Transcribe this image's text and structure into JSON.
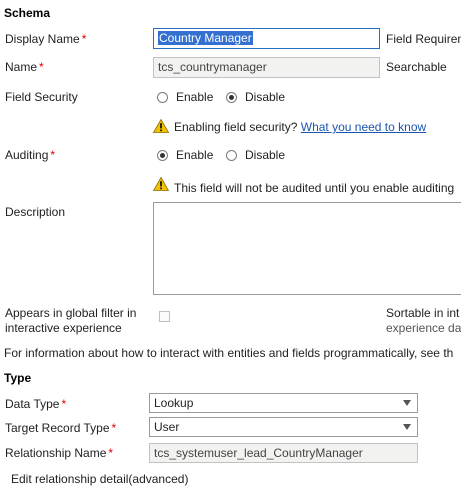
{
  "schema": {
    "header": "Schema",
    "display_name": {
      "label": "Display Name",
      "value": "Country Manager"
    },
    "field_requirement_label": "Field Requiren",
    "name": {
      "label": "Name",
      "value": "tcs_countrymanager"
    },
    "searchable_label": "Searchable",
    "field_security": {
      "label": "Field Security",
      "enable": "Enable",
      "disable": "Disable",
      "selected": "Disable",
      "warning_text": "Enabling field security?",
      "warning_link": "What you need to know"
    },
    "auditing": {
      "label": "Auditing",
      "enable": "Enable",
      "disable": "Disable",
      "selected": "Enable",
      "warning_text": "This field will not be audited until you enable auditing"
    },
    "description": {
      "label": "Description",
      "value": ""
    },
    "global_filter": {
      "label_line1": "Appears in global filter in",
      "label_line2": "interactive experience",
      "checked": false
    },
    "sortable": {
      "label_line1": "Sortable in int",
      "label_line2": "experience da"
    },
    "info_text": "For information about how to interact with entities and fields programmatically, see th"
  },
  "type": {
    "header": "Type",
    "data_type": {
      "label": "Data Type",
      "value": "Lookup"
    },
    "target_record_type": {
      "label": "Target Record Type",
      "value": "User"
    },
    "relationship_name": {
      "label": "Relationship Name",
      "value": "tcs_systemuser_lead_CountryManager"
    },
    "edit_relationship_link": "Edit relationship detail(advanced)"
  },
  "colors": {
    "required": "#e00000",
    "link": "#1a56b0",
    "focus_border": "#2a6fbf",
    "warning": "#f2c200"
  }
}
